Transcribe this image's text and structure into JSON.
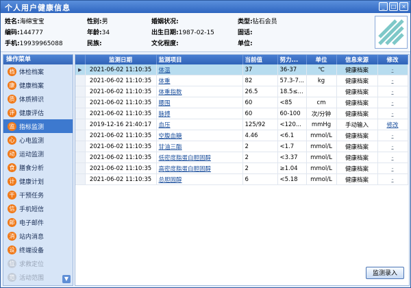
{
  "window": {
    "title": "个人用户健康信息"
  },
  "profile": {
    "name_label": "姓名:",
    "name": "海绵宝宝",
    "gender_label": "性别:",
    "gender": "男",
    "marital_label": "婚姻状况:",
    "marital": "",
    "type_label": "类型:",
    "type": "钻石会员",
    "id_label": "编码:",
    "id": "144777",
    "age_label": "年龄:",
    "age": "34",
    "birth_label": "出生日期:",
    "birth": "1987-02-15",
    "phone_label": "固话:",
    "phone": "",
    "mobile_label": "手机:",
    "mobile": "19939965088",
    "ethnic_label": "民族:",
    "ethnic": "",
    "edu_label": "文化程度:",
    "edu": "",
    "unit_label": "单位:",
    "unit": ""
  },
  "sidebar": {
    "header": "操作菜单",
    "items": [
      {
        "label": "体检档案",
        "icon": "medical-record-icon",
        "glyph": "档",
        "active": false,
        "disabled": false
      },
      {
        "label": "健康档案",
        "icon": "health-record-icon",
        "glyph": "康",
        "active": false,
        "disabled": false
      },
      {
        "label": "体质辨识",
        "icon": "constitution-icon",
        "glyph": "质",
        "active": false,
        "disabled": false
      },
      {
        "label": "健康评估",
        "icon": "assessment-icon",
        "glyph": "评",
        "active": false,
        "disabled": false
      },
      {
        "label": "指标监测",
        "icon": "monitor-icon",
        "glyph": "监",
        "active": true,
        "disabled": false
      },
      {
        "label": "心电监测",
        "icon": "ecg-icon",
        "glyph": "心",
        "active": false,
        "disabled": false
      },
      {
        "label": "运动监测",
        "icon": "exercise-icon",
        "glyph": "动",
        "active": false,
        "disabled": false
      },
      {
        "label": "膳食分析",
        "icon": "diet-icon",
        "glyph": "食",
        "active": false,
        "disabled": false
      },
      {
        "label": "健康计划",
        "icon": "plan-icon",
        "glyph": "计",
        "active": false,
        "disabled": false
      },
      {
        "label": "干预任务",
        "icon": "task-icon",
        "glyph": "干",
        "active": false,
        "disabled": false
      },
      {
        "label": "手机短信",
        "icon": "sms-icon",
        "glyph": "信",
        "active": false,
        "disabled": false
      },
      {
        "label": "电子邮件",
        "icon": "email-icon",
        "glyph": "邮",
        "active": false,
        "disabled": false
      },
      {
        "label": "站内消息",
        "icon": "message-icon",
        "glyph": "消",
        "active": false,
        "disabled": false
      },
      {
        "label": "终端设备",
        "icon": "device-icon",
        "glyph": "设",
        "active": false,
        "disabled": false
      },
      {
        "label": "求救定位",
        "icon": "location-icon",
        "glyph": "位",
        "active": false,
        "disabled": true
      },
      {
        "label": "活动范围",
        "icon": "range-icon",
        "glyph": "范",
        "active": false,
        "disabled": true
      }
    ]
  },
  "table": {
    "columns": [
      "监测日期",
      "监测项目",
      "当前值",
      "努力...",
      "单位",
      "信息来源",
      "修改"
    ],
    "rows": [
      {
        "date": "2021-06-02 11:10:35",
        "item": "体温",
        "value": "37",
        "target": "36-37",
        "unit": "℃",
        "source": "健康档案",
        "edit": "-",
        "selected": true
      },
      {
        "date": "2021-06-02 11:10:35",
        "item": "体重",
        "value": "82",
        "target": "57.3-7...",
        "unit": "kg",
        "source": "健康档案",
        "edit": "-",
        "selected": false
      },
      {
        "date": "2021-06-02 11:10:35",
        "item": "体重指数",
        "value": "26.5",
        "target": "18.5≤...",
        "unit": "",
        "source": "健康档案",
        "edit": "-",
        "selected": false
      },
      {
        "date": "2021-06-02 11:10:35",
        "item": "腰围",
        "value": "60",
        "target": "<85",
        "unit": "cm",
        "source": "健康档案",
        "edit": "-",
        "selected": false
      },
      {
        "date": "2021-06-02 11:10:35",
        "item": "脉搏",
        "value": "60",
        "target": "60-100",
        "unit": "次/分钟",
        "source": "健康档案",
        "edit": "-",
        "selected": false
      },
      {
        "date": "2019-12-16 21:40:17",
        "item": "血压",
        "value": "125/92",
        "target": "<120...",
        "unit": "mmHg",
        "source": "手动输入",
        "edit": "修改",
        "selected": false
      },
      {
        "date": "2021-06-02 11:10:35",
        "item": "空腹血糖",
        "value": "4.46",
        "target": "<6.1",
        "unit": "mmol/L",
        "source": "健康档案",
        "edit": "-",
        "selected": false
      },
      {
        "date": "2021-06-02 11:10:35",
        "item": "甘油三酯",
        "value": "2",
        "target": "<1.7",
        "unit": "mmol/L",
        "source": "健康档案",
        "edit": "-",
        "selected": false
      },
      {
        "date": "2021-06-02 11:10:35",
        "item": "低密度脂蛋白胆固醇",
        "value": "2",
        "target": "<3.37",
        "unit": "mmol/L",
        "source": "健康档案",
        "edit": "-",
        "selected": false
      },
      {
        "date": "2021-06-02 11:10:35",
        "item": "高密度脂蛋白胆固醇",
        "value": "2",
        "target": "≥1.04",
        "unit": "mmol/L",
        "source": "健康档案",
        "edit": "-",
        "selected": false
      },
      {
        "date": "2021-06-02 11:10:35",
        "item": "总胆固醇",
        "value": "6",
        "target": "<5.18",
        "unit": "mmol/L",
        "source": "健康档案",
        "edit": "-",
        "selected": false
      }
    ]
  },
  "actions": {
    "entry_label": "监测录入"
  },
  "icons": {
    "minimize": "minimize-icon",
    "maximize": "maximize-icon",
    "close": "close-icon",
    "row_pointer": "row-pointer-icon",
    "scroll_down": "chevron-down-icon"
  },
  "colors": {
    "titlebar": "#2f66c0",
    "active_menu": "#3d79cf",
    "menu_icon": "#f07a1a",
    "selected_row": "#b7dcef"
  }
}
